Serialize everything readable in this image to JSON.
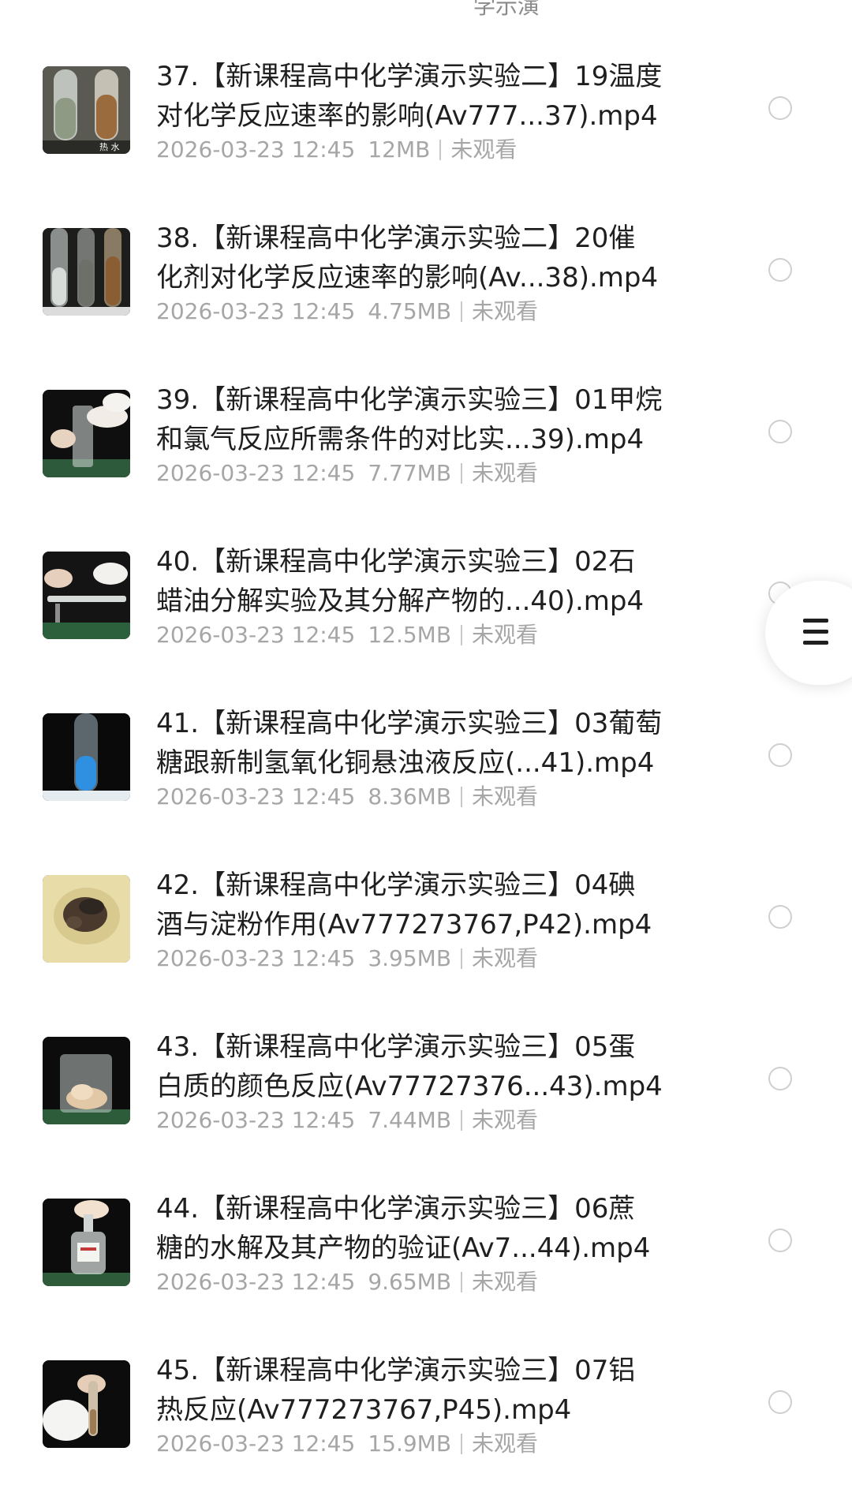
{
  "header": {
    "cut_text": "学示演"
  },
  "files": [
    {
      "title": "37.【新课程高中化学演示实验二】19温度\n对化学反应速率的影响(Av777...37).mp4",
      "date": "2026-03-23 12:45",
      "size": "12MB",
      "status": "未观看",
      "thumb_icon": "test-tubes-water-thumbnail",
      "thumb_caption": "热 水"
    },
    {
      "title": "38.【新课程高中化学演示实验二】20催\n化剂对化学反应速率的影响(Av...38).mp4",
      "date": "2026-03-23 12:45",
      "size": "4.75MB",
      "status": "未观看",
      "thumb_icon": "three-test-tubes-thumbnail"
    },
    {
      "title": "39.【新课程高中化学演示实验三】01甲烷\n和氯气反应所需条件的对比实...39).mp4",
      "date": "2026-03-23 12:45",
      "size": "7.77MB",
      "status": "未观看",
      "thumb_icon": "hands-gas-cylinder-thumbnail"
    },
    {
      "title": "40.【新课程高中化学演示实验三】02石\n蜡油分解实验及其分解产物的...40).mp4",
      "date": "2026-03-23 12:45",
      "size": "12.5MB",
      "status": "未观看",
      "thumb_icon": "glass-tube-heating-thumbnail"
    },
    {
      "title": "41.【新课程高中化学演示实验三】03葡萄\n糖跟新制氢氧化铜悬浊液反应(...41).mp4",
      "date": "2026-03-23 12:45",
      "size": "8.36MB",
      "status": "未观看",
      "thumb_icon": "blue-solution-tube-thumbnail"
    },
    {
      "title": "42.【新课程高中化学演示实验三】04碘\n酒与淀粉作用(Av777273767,P42).mp4",
      "date": "2026-03-23 12:45",
      "size": "3.95MB",
      "status": "未观看",
      "thumb_icon": "iodine-starch-stain-thumbnail"
    },
    {
      "title": "43.【新课程高中化学演示实验三】05蛋\n白质的颜色反应(Av77727376...43).mp4",
      "date": "2026-03-23 12:45",
      "size": "7.44MB",
      "status": "未观看",
      "thumb_icon": "beaker-protein-thumbnail"
    },
    {
      "title": "44.【新课程高中化学演示实验三】06蔗\n糖的水解及其产物的验证(Av7...44).mp4",
      "date": "2026-03-23 12:45",
      "size": "9.65MB",
      "status": "未观看",
      "thumb_icon": "reagent-bottle-thumbnail"
    },
    {
      "title": "45.【新课程高中化学演示实验三】07铝\n热反应(Av777273767,P45).mp4",
      "date": "2026-03-23 12:45",
      "size": "15.9MB",
      "status": "未观看",
      "thumb_icon": "gloved-hand-tube-thumbnail"
    }
  ],
  "floating_menu": {
    "icon": "hamburger-menu-icon"
  },
  "colors": {
    "title_text": "#1f1f1f",
    "meta_text": "#a6a6a6",
    "radio_border": "#cfcfcf"
  }
}
